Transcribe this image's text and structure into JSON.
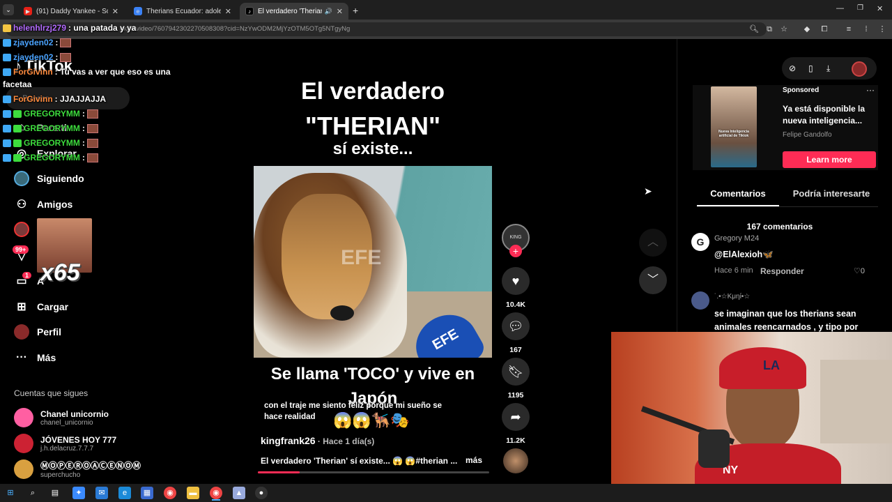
{
  "tabs": [
    {
      "title": "(91) Daddy Yankee - Somos de",
      "icon": "youtube-icon",
      "color": "#e62117"
    },
    {
      "title": "Therians Ecuador: adolescente",
      "icon": "site-icon",
      "color": "#3b82f6"
    },
    {
      "title": "El verdadero 'Therian' sí exi",
      "icon": "tiktok-icon",
      "color": "#000000"
    }
  ],
  "url": "nk26/video/7607942302270508308?cid=NzYwODM2MjYzOTM5OTg5NTgyNg",
  "chat": [
    {
      "user": "helenhlrzj279",
      "msg": ": una patada y ya",
      "color": "#b36bff",
      "emote": false
    },
    {
      "user": "zjayden02",
      "msg": ":",
      "color": "#4aa3ff",
      "emote": true
    },
    {
      "user": "zjayden02",
      "msg": ":",
      "color": "#4aa3ff",
      "emote": true
    },
    {
      "user": "ForGivinn",
      "msg": ": Tu vas a ver que eso es una",
      "color": "#ff8a3d",
      "emote": false
    },
    {
      "user": "",
      "msg": "facetaa",
      "color": "#ffffff",
      "emote": false
    },
    {
      "user": "ForGivinn",
      "msg": ": JJAJJAJJA",
      "color": "#ff8a3d",
      "emote": false
    },
    {
      "user": "GREGORYMM",
      "msg": ":",
      "color": "#3ddc3d",
      "emote": true
    },
    {
      "user": "GREGORYMM",
      "msg": ":",
      "color": "#3ddc3d",
      "emote": true
    },
    {
      "user": "GREGORYMM",
      "msg": ":",
      "color": "#3ddc3d",
      "emote": true
    },
    {
      "user": "GREGORYMM",
      "msg": ":",
      "color": "#3ddc3d",
      "emote": true
    }
  ],
  "logo": "TikTok",
  "search_placeholder": "Buscar",
  "nav": [
    {
      "label": "Para ti",
      "icon": "home-icon"
    },
    {
      "label": "Explorar",
      "icon": "compass-icon"
    },
    {
      "label": "Siguiendo",
      "icon": "following-icon"
    },
    {
      "label": "Amigos",
      "icon": "friends-icon"
    },
    {
      "label": "",
      "icon": "live-icon"
    },
    {
      "label": "",
      "icon": "activity-icon",
      "badge": "99+"
    },
    {
      "label": "A",
      "icon": "messages-icon",
      "badge": "1"
    },
    {
      "label": "Cargar",
      "icon": "upload-icon"
    },
    {
      "label": "Perfil",
      "icon": "profile-icon"
    },
    {
      "label": "Más",
      "icon": "more-icon"
    }
  ],
  "emote_multiplier": "x65",
  "following_title": "Cuentas que sigues",
  "following": [
    {
      "name": "Chanel unicornio",
      "handle": "chanel_unicornio",
      "color": "#ff5fa2"
    },
    {
      "name": "JÓVENES HOY 777",
      "handle": "j.h.delacruz.7.7.7",
      "color": "#c23"
    },
    {
      "name": "ⓂⓄⓅⒺⓇⓄⒶⒸⒺⓃⓄⓂ",
      "handle": "superchucho",
      "color": "#d9a040"
    }
  ],
  "video": {
    "title1": "El verdadero",
    "title2": "\"THERIAN\"",
    "title3": "sí existe...",
    "caption_big1": "Se llama 'TOCO' y vive en",
    "caption_big2": "Japón",
    "subtitle1": "con el traje me siento feliz porque mi sueño se",
    "subtitle2": "hace realidad",
    "emoji": "😱😱🐕‍🦺🎭",
    "watermark": "EFE",
    "mic": "EFE",
    "author": "kingfrank26",
    "time": " · Hace 1 día(s)",
    "desc": "El verdadero 'Therian' sí existe... 😱 😱#therian ...",
    "more": "más",
    "progress": 0.18
  },
  "actions": {
    "likes": "10.4K",
    "comments": "167",
    "saves": "1195",
    "shares": "11.2K",
    "avatar_label": "KING"
  },
  "ad": {
    "label": "Sponsored",
    "title": "Ya está disponible la nueva inteligencia...",
    "advertiser": "Felipe Gandolfo",
    "cta": "Learn more",
    "thumb_text": "Nueva Inteligencia artificial de Tiktok"
  },
  "tabs_right": {
    "comments": "Comentarios",
    "interest": "Podría interesarte"
  },
  "comments_count": "167 comentarios",
  "comments": [
    {
      "user": "Gregory M24",
      "text": "@ElAlexioh🦋",
      "time": "Hace 6 min",
      "reply": "Responder",
      "likes": "0"
    },
    {
      "user": "˙.•☆Kμηί•☆",
      "text": "se imaginan que los therians sean animales reencarnados , y tipo por",
      "time": "",
      "reply": "",
      "likes": ""
    }
  ],
  "webcam": {
    "cap_text": "LA",
    "shirt_text": "NY"
  }
}
